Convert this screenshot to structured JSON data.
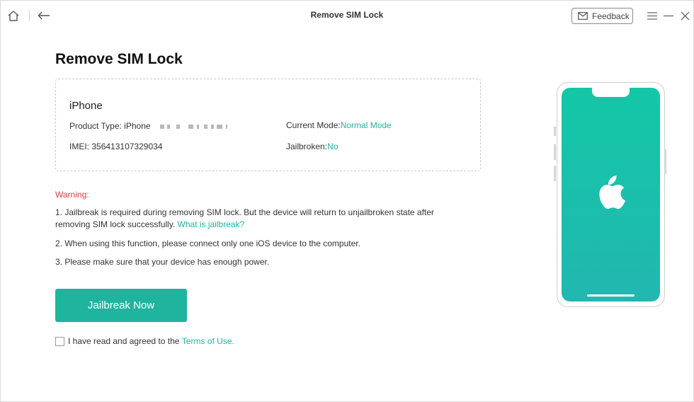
{
  "window": {
    "title": "Remove SIM Lock",
    "feedback_label": "Feedback"
  },
  "page": {
    "title": "Remove SIM Lock"
  },
  "device": {
    "name": "iPhone",
    "product_type_label": "Product Type:",
    "product_type_value": "iPhone",
    "imei_label": "IMEI:",
    "imei_value": "356413107329034",
    "mode_label": "Current Mode:",
    "mode_value": "Normal Mode",
    "jailbroken_label": "Jailbroken:",
    "jailbroken_value": "No"
  },
  "warning": {
    "title": "Warning:",
    "note1_text": "1. Jailbreak is required during removing SIM lock. But the device will return to unjailbroken state after removing SIM lock successfully.",
    "note1_link": "What is jailbreak?",
    "note2": "2. When using this function, please connect only one iOS device to the computer.",
    "note3": "3. Please make sure that your device has enough power."
  },
  "actions": {
    "jailbreak_label": "Jailbreak Now"
  },
  "terms": {
    "text": "I have read and agreed to the",
    "link": "Terms of Use.",
    "checked": false
  },
  "colors": {
    "accent": "#1fb49e",
    "warning": "#e23b3b",
    "link": "#21b4a0"
  },
  "icons": [
    "home-icon",
    "back-arrow-icon",
    "mail-icon",
    "menu-icon",
    "minimize-icon",
    "close-icon",
    "apple-logo-icon"
  ]
}
